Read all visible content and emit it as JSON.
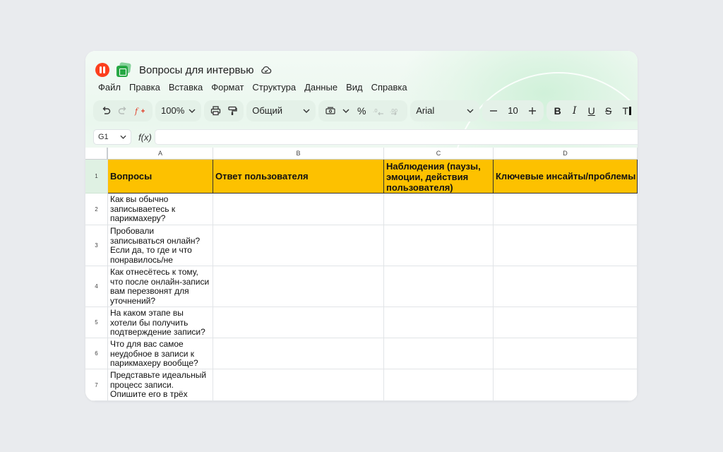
{
  "app": {
    "doc_title": "Вопросы для интервью",
    "menu": [
      "Файл",
      "Правка",
      "Вставка",
      "Формат",
      "Структура",
      "Данные",
      "Вид",
      "Справка"
    ]
  },
  "toolbar": {
    "zoom": "100%",
    "format": "Общий",
    "font": "Arial",
    "font_size": "10",
    "percent": "%"
  },
  "formula_bar": {
    "cell_ref": "G1",
    "fx_label": "f(x)",
    "value": ""
  },
  "sheet": {
    "columns": [
      "A",
      "B",
      "C",
      "D"
    ],
    "header_row": {
      "num": "1",
      "cells": [
        "Вопросы",
        "Ответ пользователя",
        "Наблюдения (паузы, эмоции, действия пользователя)",
        "Ключевые инсайты/проблемы"
      ]
    },
    "rows": [
      {
        "num": "2",
        "question": "Как вы обычно записываетесь к парикмахеру?"
      },
      {
        "num": "3",
        "question": "Пробовали записываться онлайн? Если да, то где и что понравилось/не понравилось?"
      },
      {
        "num": "4",
        "question": "Как отнесётесь к тому, что после онлайн-записи вам перезвонят для уточнений?"
      },
      {
        "num": "5",
        "question": "На каком этапе вы хотели бы получить подтверждение записи?"
      },
      {
        "num": "6",
        "question": "Что для вас самое неудобное в записи к парикмахеру вообще?"
      },
      {
        "num": "7",
        "question": "Представьте идеальный процесс записи. Опишите его в трёх словах"
      }
    ]
  },
  "colors": {
    "header_fill": "#fdc100",
    "accent_green": "#27a844",
    "brand_red": "#fc3f1d"
  }
}
